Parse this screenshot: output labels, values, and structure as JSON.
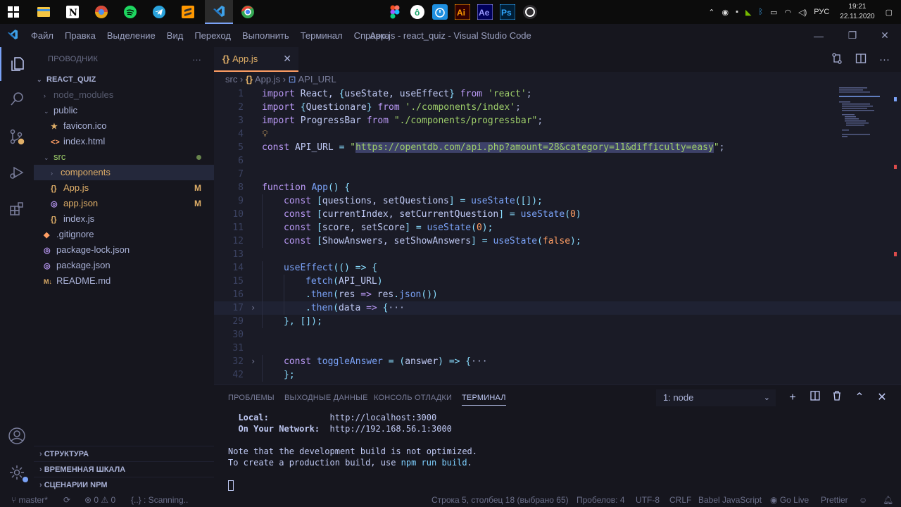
{
  "taskbar": {
    "center_labels": {
      "ai": "Ai",
      "ae": "Ae",
      "ps": "Ps"
    },
    "tray": {
      "lang": "РУС",
      "time": "19:21",
      "date": "22.11.2020"
    }
  },
  "titlebar": {
    "menu": [
      "Файл",
      "Правка",
      "Выделение",
      "Вид",
      "Переход",
      "Выполнить",
      "Терминал",
      "Справка"
    ],
    "title": "App.js - react_quiz - Visual Studio Code"
  },
  "sidebar": {
    "header": "ПРОВОДНИК",
    "dots": "···",
    "root": "REACT_QUIZ",
    "items": [
      {
        "label": "node_modules",
        "icon": "›",
        "kind": "folder-collapsed"
      },
      {
        "label": "public",
        "icon": "⌄",
        "kind": "folder-open"
      },
      {
        "label": "favicon.ico",
        "icon": "★"
      },
      {
        "label": "index.html",
        "icon": "<>"
      },
      {
        "label": "src",
        "icon": "⌄",
        "kind": "folder-open"
      },
      {
        "label": "components",
        "icon": "›",
        "kind": "folder-collapsed"
      },
      {
        "label": "App.js",
        "icon": "{}",
        "badge": "M"
      },
      {
        "label": "app.json",
        "icon": "◎",
        "badge": "M"
      },
      {
        "label": "index.js",
        "icon": "{}"
      },
      {
        "label": ".gitignore",
        "icon": "◆"
      },
      {
        "label": "package-lock.json",
        "icon": "◎"
      },
      {
        "label": "package.json",
        "icon": "◎"
      },
      {
        "label": "README.md",
        "icon": "M↓"
      }
    ],
    "panels": [
      "СТРУКТУРА",
      "ВРЕМЕННАЯ ШКАЛА",
      "СЦЕНАРИИ NPM"
    ]
  },
  "tab": {
    "label": "App.js",
    "icon": "{}"
  },
  "breadcrumb": {
    "a": "src",
    "b": "App.js",
    "c": "API_URL"
  },
  "code": {
    "lines": [
      {
        "n": "1",
        "tokens": [
          [
            "k",
            "import "
          ],
          [
            "v",
            "React, "
          ],
          [
            "p",
            "{"
          ],
          [
            "v",
            "useState, useEffect"
          ],
          [
            "p",
            "}"
          ],
          [
            "k",
            " from "
          ],
          [
            "s",
            "'react'"
          ],
          [
            "d",
            ";"
          ]
        ]
      },
      {
        "n": "2",
        "tokens": [
          [
            "k",
            "import "
          ],
          [
            "p",
            "{"
          ],
          [
            "v",
            "Questionare"
          ],
          [
            "p",
            "}"
          ],
          [
            "k",
            " from "
          ],
          [
            "s",
            "'./components/index'"
          ],
          [
            "d",
            ";"
          ]
        ]
      },
      {
        "n": "3",
        "tokens": [
          [
            "k",
            "import "
          ],
          [
            "v",
            "ProgressBar "
          ],
          [
            "k",
            "from "
          ],
          [
            "s",
            "\"./components/progressbar\""
          ],
          [
            "d",
            ";"
          ]
        ]
      },
      {
        "n": "4",
        "tokens": [],
        "bulb": true
      },
      {
        "n": "5",
        "tokens": [
          [
            "k",
            "const "
          ],
          [
            "v",
            "API_URL "
          ],
          [
            "p",
            "= "
          ],
          [
            "s",
            "\""
          ],
          [
            "s",
            "url",
            "https://opentdb.com/api.php?amount=28&category=11&difficulty=easy"
          ],
          [
            "s",
            "\""
          ],
          [
            "d",
            ";"
          ]
        ]
      },
      {
        "n": "6",
        "tokens": []
      },
      {
        "n": "7",
        "tokens": []
      },
      {
        "n": "8",
        "tokens": [
          [
            "k",
            "function "
          ],
          [
            "f",
            "App"
          ],
          [
            "p",
            "() {"
          ]
        ]
      },
      {
        "n": "9",
        "indent": 1,
        "tokens": [
          [
            "k",
            "const "
          ],
          [
            "p",
            "["
          ],
          [
            "v",
            "questions, setQuestions"
          ],
          [
            "p",
            "] = "
          ],
          [
            "f",
            "useState"
          ],
          [
            "p",
            "([]);"
          ]
        ]
      },
      {
        "n": "10",
        "indent": 1,
        "tokens": [
          [
            "k",
            "const "
          ],
          [
            "p",
            "["
          ],
          [
            "v",
            "currentIndex, setCurrentQuestion"
          ],
          [
            "p",
            "] = "
          ],
          [
            "f",
            "useState"
          ],
          [
            "p",
            "("
          ],
          [
            "n",
            "0"
          ],
          [
            "p",
            ")"
          ]
        ]
      },
      {
        "n": "11",
        "indent": 1,
        "tokens": [
          [
            "k",
            "const "
          ],
          [
            "p",
            "["
          ],
          [
            "v",
            "score, setScore"
          ],
          [
            "p",
            "] = "
          ],
          [
            "f",
            "useState"
          ],
          [
            "p",
            "("
          ],
          [
            "n",
            "0"
          ],
          [
            "p",
            ");"
          ]
        ]
      },
      {
        "n": "12",
        "indent": 1,
        "tokens": [
          [
            "k",
            "const "
          ],
          [
            "p",
            "["
          ],
          [
            "v",
            "ShowAnswers, setShowAnswers"
          ],
          [
            "p",
            "] = "
          ],
          [
            "f",
            "useState"
          ],
          [
            "p",
            "("
          ],
          [
            "n",
            "false"
          ],
          [
            "p",
            ");"
          ]
        ]
      },
      {
        "n": "13",
        "tokens": []
      },
      {
        "n": "14",
        "indent": 1,
        "tokens": [
          [
            "f",
            "useEffect"
          ],
          [
            "p",
            "(() => {"
          ]
        ]
      },
      {
        "n": "15",
        "indent": 2,
        "tokens": [
          [
            "f",
            "fetch"
          ],
          [
            "p",
            "("
          ],
          [
            "v",
            "API_URL"
          ],
          [
            "p",
            ")"
          ]
        ]
      },
      {
        "n": "16",
        "indent": 2,
        "tokens": [
          [
            "p",
            "."
          ],
          [
            "f",
            "then"
          ],
          [
            "p",
            "("
          ],
          [
            "v",
            "res "
          ],
          [
            "k",
            "=> "
          ],
          [
            "v",
            "res"
          ],
          [
            "p",
            "."
          ],
          [
            "f",
            "json"
          ],
          [
            "p",
            "())"
          ]
        ]
      },
      {
        "n": "17",
        "indent": 2,
        "fold": true,
        "cur": true,
        "tokens": [
          [
            "p",
            "."
          ],
          [
            "f",
            "then"
          ],
          [
            "p",
            "("
          ],
          [
            "v",
            "data "
          ],
          [
            "k",
            "=> "
          ],
          [
            "p",
            "{"
          ],
          [
            "d",
            "···"
          ]
        ]
      },
      {
        "n": "29",
        "indent": 1,
        "tokens": [
          [
            "p",
            "}, []);"
          ]
        ]
      },
      {
        "n": "30",
        "tokens": []
      },
      {
        "n": "31",
        "tokens": []
      },
      {
        "n": "32",
        "indent": 1,
        "fold": true,
        "tokens": [
          [
            "k",
            "const "
          ],
          [
            "f",
            "toggleAnswer "
          ],
          [
            "p",
            "= ("
          ],
          [
            "v",
            "answer"
          ],
          [
            "p",
            ") => {"
          ],
          [
            "d",
            "···"
          ]
        ]
      },
      {
        "n": "42",
        "indent": 1,
        "tokens": [
          [
            "p",
            "};"
          ]
        ]
      }
    ]
  },
  "panel": {
    "tabs": [
      "ПРОБЛЕМЫ",
      "ВЫХОДНЫЕ ДАННЫЕ",
      "КОНСОЛЬ ОТЛАДКИ",
      "ТЕРМИНАЛ"
    ],
    "terminal_select": "1: node",
    "terminal": {
      "local_label": "Local:",
      "local_url": "http://localhost:3000",
      "network_label": "On Your Network:",
      "network_url": "http://192.168.56.1:3000",
      "note1": "Note that the development build is not optimized.",
      "note2_a": "To create a production build, use ",
      "note2_cmd": "npm run build",
      "note2_b": "."
    }
  },
  "status": {
    "branch": "master*",
    "errors": "0",
    "warnings": "0",
    "scanning": "{..} : Scanning..",
    "position": "Строка 5, столбец 18 (выбрано 65)",
    "spaces": "Пробелов: 4",
    "encoding": "UTF-8",
    "eol": "CRLF",
    "language": "Babel JavaScript",
    "golive": "Go Live",
    "prettier": "Prettier"
  }
}
